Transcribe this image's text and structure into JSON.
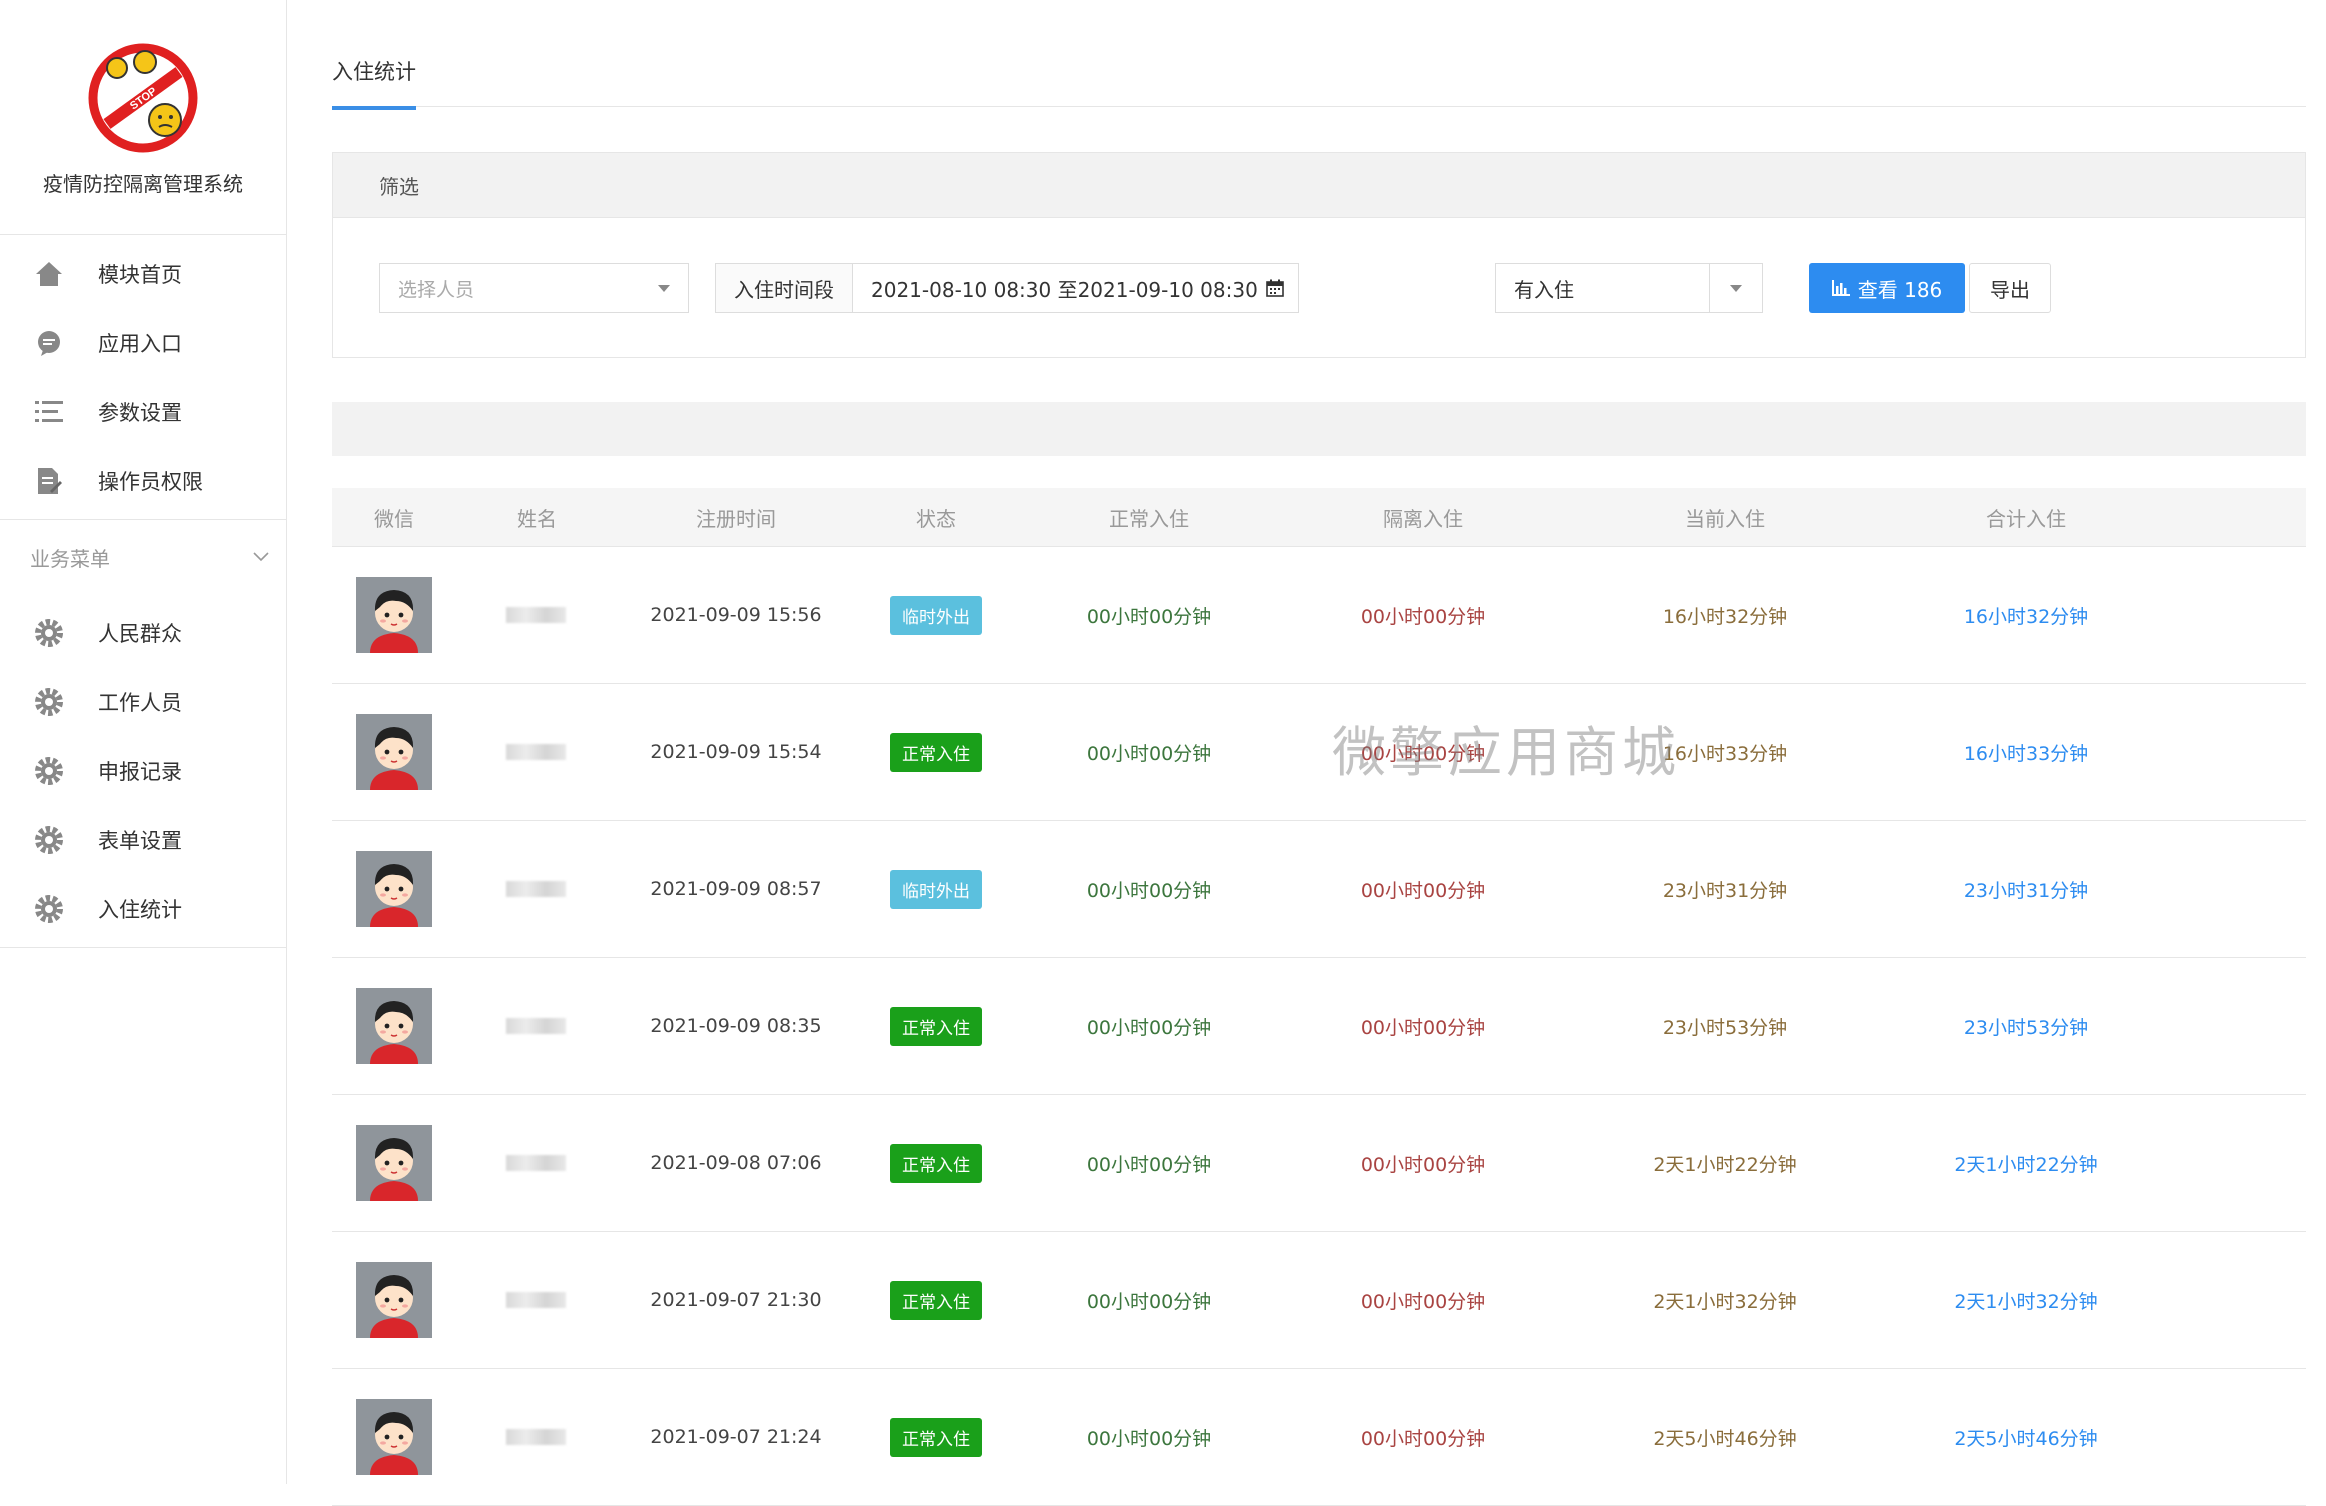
{
  "app": {
    "name": "疫情防控隔离管理系统",
    "logo_text": "STOP"
  },
  "sidebar": {
    "items": [
      {
        "label": "模块首页",
        "icon": "home-icon"
      },
      {
        "label": "应用入口",
        "icon": "chat-icon"
      },
      {
        "label": "参数设置",
        "icon": "list-icon"
      },
      {
        "label": "操作员权限",
        "icon": "edit-doc-icon"
      }
    ],
    "group_title": "业务菜单",
    "group_items": [
      {
        "label": "人民群众",
        "icon": "gear-icon"
      },
      {
        "label": "工作人员",
        "icon": "gear-icon"
      },
      {
        "label": "申报记录",
        "icon": "gear-icon"
      },
      {
        "label": "表单设置",
        "icon": "gear-icon"
      },
      {
        "label": "入住统计",
        "icon": "gear-icon"
      }
    ]
  },
  "tabs": {
    "active": "入住统计"
  },
  "filter": {
    "title": "筛选",
    "person_placeholder": "选择人员",
    "date_label": "入住时间段",
    "date_value": "2021-08-10 08:30 至2021-09-10 08:30",
    "status_value": "有入住",
    "view_button": "查看 186",
    "export_button": "导出"
  },
  "table": {
    "headers": [
      "微信",
      "姓名",
      "注册时间",
      "状态",
      "正常入住",
      "隔离入住",
      "当前入住",
      "合计入住"
    ],
    "rows": [
      {
        "reg": "2021-09-09 15:56",
        "status": "临时外出",
        "status_type": "out",
        "normal": "00小时00分钟",
        "iso": "00小时00分钟",
        "cur": "16小时32分钟",
        "total": "16小时32分钟"
      },
      {
        "reg": "2021-09-09 15:54",
        "status": "正常入住",
        "status_type": "in",
        "normal": "00小时00分钟",
        "iso": "00小时00分钟",
        "cur": "16小时33分钟",
        "total": "16小时33分钟"
      },
      {
        "reg": "2021-09-09 08:57",
        "status": "临时外出",
        "status_type": "out",
        "normal": "00小时00分钟",
        "iso": "00小时00分钟",
        "cur": "23小时31分钟",
        "total": "23小时31分钟"
      },
      {
        "reg": "2021-09-09 08:35",
        "status": "正常入住",
        "status_type": "in",
        "normal": "00小时00分钟",
        "iso": "00小时00分钟",
        "cur": "23小时53分钟",
        "total": "23小时53分钟"
      },
      {
        "reg": "2021-09-08 07:06",
        "status": "正常入住",
        "status_type": "in",
        "normal": "00小时00分钟",
        "iso": "00小时00分钟",
        "cur": "2天1小时22分钟",
        "total": "2天1小时22分钟"
      },
      {
        "reg": "2021-09-07 21:30",
        "status": "正常入住",
        "status_type": "in",
        "normal": "00小时00分钟",
        "iso": "00小时00分钟",
        "cur": "2天1小时32分钟",
        "total": "2天1小时32分钟"
      },
      {
        "reg": "2021-09-07 21:24",
        "status": "正常入住",
        "status_type": "in",
        "normal": "00小时00分钟",
        "iso": "00小时00分钟",
        "cur": "2天5小时46分钟",
        "total": "2天5小时46分钟"
      }
    ]
  },
  "watermark": "微擎应用商城",
  "colors": {
    "accent": "#2d8cf0",
    "badge_out": "#5bc0de",
    "badge_in": "#1aa01a"
  }
}
